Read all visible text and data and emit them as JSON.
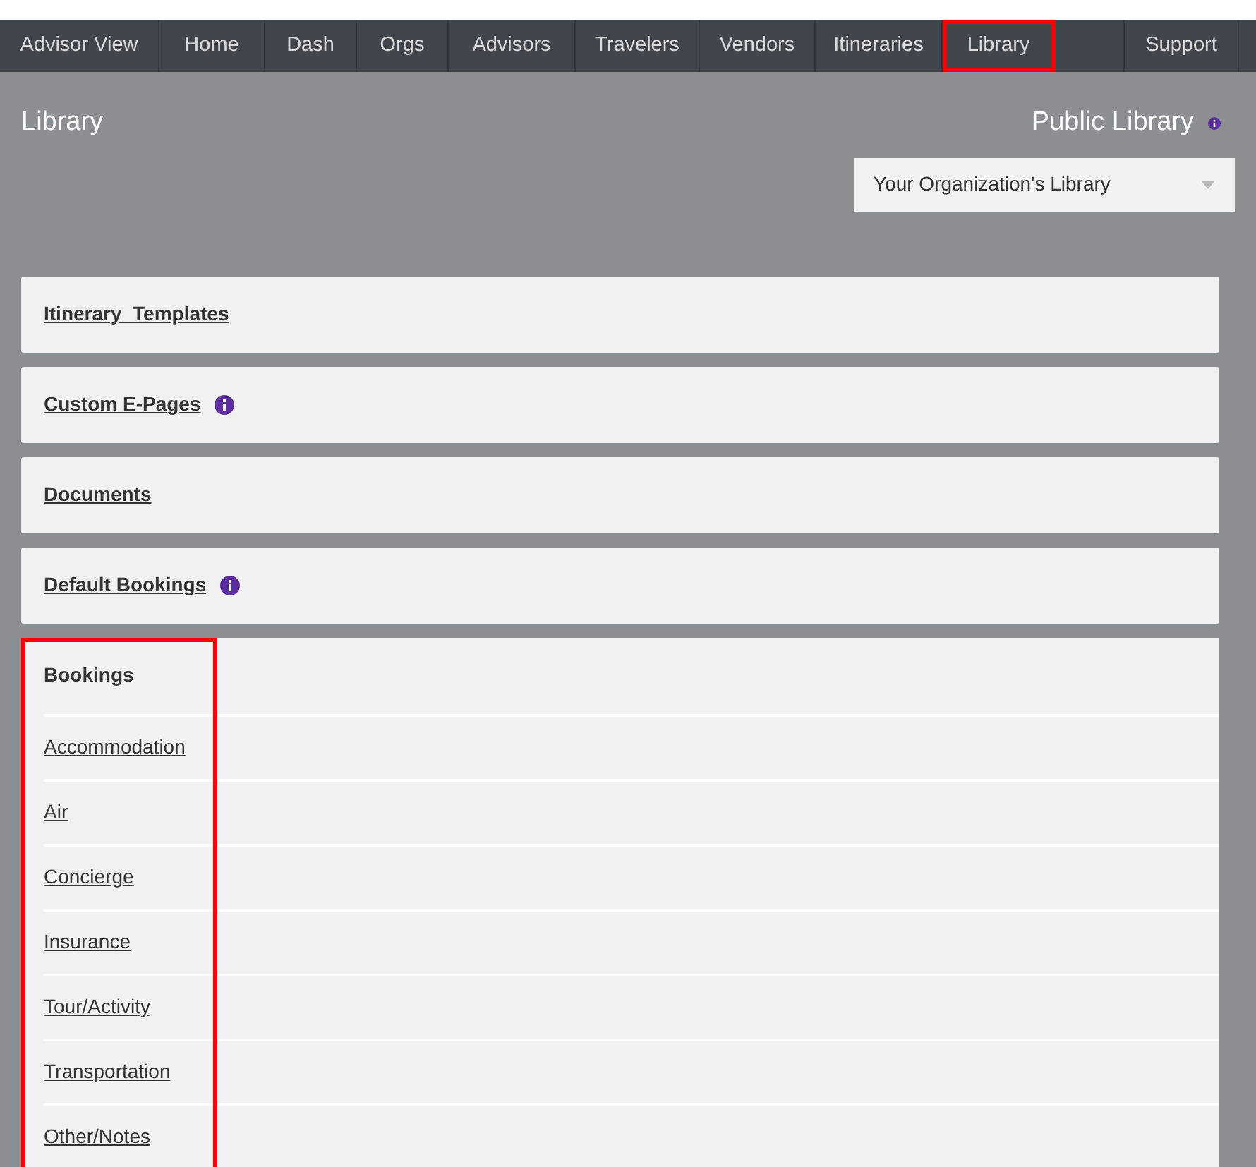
{
  "nav": {
    "items": [
      {
        "label": "Advisor View",
        "highlighted": false
      },
      {
        "label": "Home",
        "highlighted": false
      },
      {
        "label": "Dash",
        "highlighted": false
      },
      {
        "label": "Orgs",
        "highlighted": false
      },
      {
        "label": "Advisors",
        "highlighted": false
      },
      {
        "label": "Travelers",
        "highlighted": false
      },
      {
        "label": "Vendors",
        "highlighted": false
      },
      {
        "label": "Itineraries",
        "highlighted": false
      },
      {
        "label": "Library",
        "highlighted": true
      }
    ],
    "right_items": [
      {
        "label": "Support",
        "highlighted": false
      }
    ]
  },
  "header": {
    "title": "Library",
    "public_library": {
      "label": "Public Library",
      "info": true
    },
    "library_select": {
      "value": "Your Organization's Library"
    }
  },
  "sections": [
    {
      "title": "Itinerary  Templates",
      "info": false
    },
    {
      "title": "Custom E-Pages",
      "info": true
    },
    {
      "title": "Documents",
      "info": false
    },
    {
      "title": "Default Bookings",
      "info": true
    }
  ],
  "bookings": {
    "title": "Bookings",
    "highlighted": true,
    "items": [
      "Accommodation",
      "Air",
      "Concierge",
      "Insurance",
      "Tour/Activity",
      "Transportation",
      "Other/Notes"
    ]
  }
}
